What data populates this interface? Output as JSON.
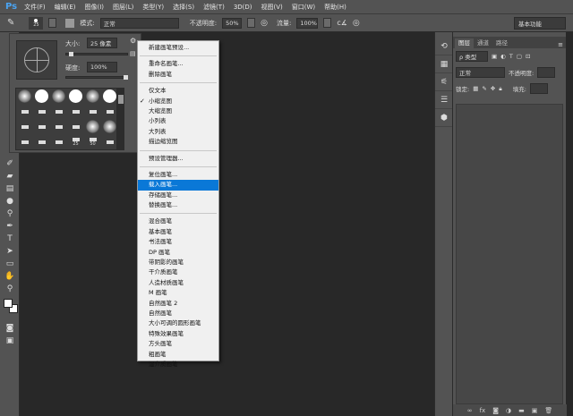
{
  "app": {
    "logo": "Ps"
  },
  "menubar": [
    "文件(F)",
    "编辑(E)",
    "图像(I)",
    "图层(L)",
    "类型(Y)",
    "选择(S)",
    "滤镜(T)",
    "3D(D)",
    "视图(V)",
    "窗口(W)",
    "帮助(H)"
  ],
  "options": {
    "brush_size": "25",
    "mode_label": "模式:",
    "mode_value": "正常",
    "opacity_label": "不透明度:",
    "opacity_value": "50%",
    "flow_label": "流量:",
    "flow_value": "100%",
    "workspace": "基本功能"
  },
  "brush_panel": {
    "size_label": "大小:",
    "size_value": "25 像素",
    "hardness_label": "硬度:",
    "hardness_value": "100%",
    "size_fraction": 0.05,
    "hardness_fraction": 1.0,
    "grid_labels": [
      "25",
      "50"
    ]
  },
  "context_menu": {
    "groups": [
      [
        {
          "label": "新建画笔预设..."
        }
      ],
      [
        {
          "label": "重命名画笔..."
        },
        {
          "label": "删除画笔"
        }
      ],
      [
        {
          "label": "仅文本"
        },
        {
          "label": "小缩览图",
          "checked": true
        },
        {
          "label": "大缩览图"
        },
        {
          "label": "小列表"
        },
        {
          "label": "大列表"
        },
        {
          "label": "描边缩览图"
        }
      ],
      [
        {
          "label": "预设管理器..."
        }
      ],
      [
        {
          "label": "复位画笔..."
        },
        {
          "label": "载入画笔...",
          "highlighted": true
        },
        {
          "label": "存储画笔..."
        },
        {
          "label": "替换画笔..."
        }
      ],
      [
        {
          "label": "混合画笔"
        },
        {
          "label": "基本画笔"
        },
        {
          "label": "书法画笔"
        },
        {
          "label": "DP 画笔"
        },
        {
          "label": "带阴影的画笔"
        },
        {
          "label": "干介质画笔"
        },
        {
          "label": "人造材质画笔"
        },
        {
          "label": "M 画笔"
        },
        {
          "label": "自然画笔 2"
        },
        {
          "label": "自然画笔"
        },
        {
          "label": "大小可调的圆形画笔"
        },
        {
          "label": "特殊效果画笔"
        },
        {
          "label": "方头画笔"
        },
        {
          "label": "粗画笔"
        },
        {
          "label": "湿介质画笔"
        }
      ]
    ],
    "checkmark": "✓"
  },
  "layers_panel": {
    "tabs": [
      "图层",
      "通道",
      "路径"
    ],
    "filter": "ρ 类型",
    "blend": "正常",
    "opacity_label": "不透明度:",
    "lock_label": "锁定:",
    "fill_label": "填充:"
  }
}
